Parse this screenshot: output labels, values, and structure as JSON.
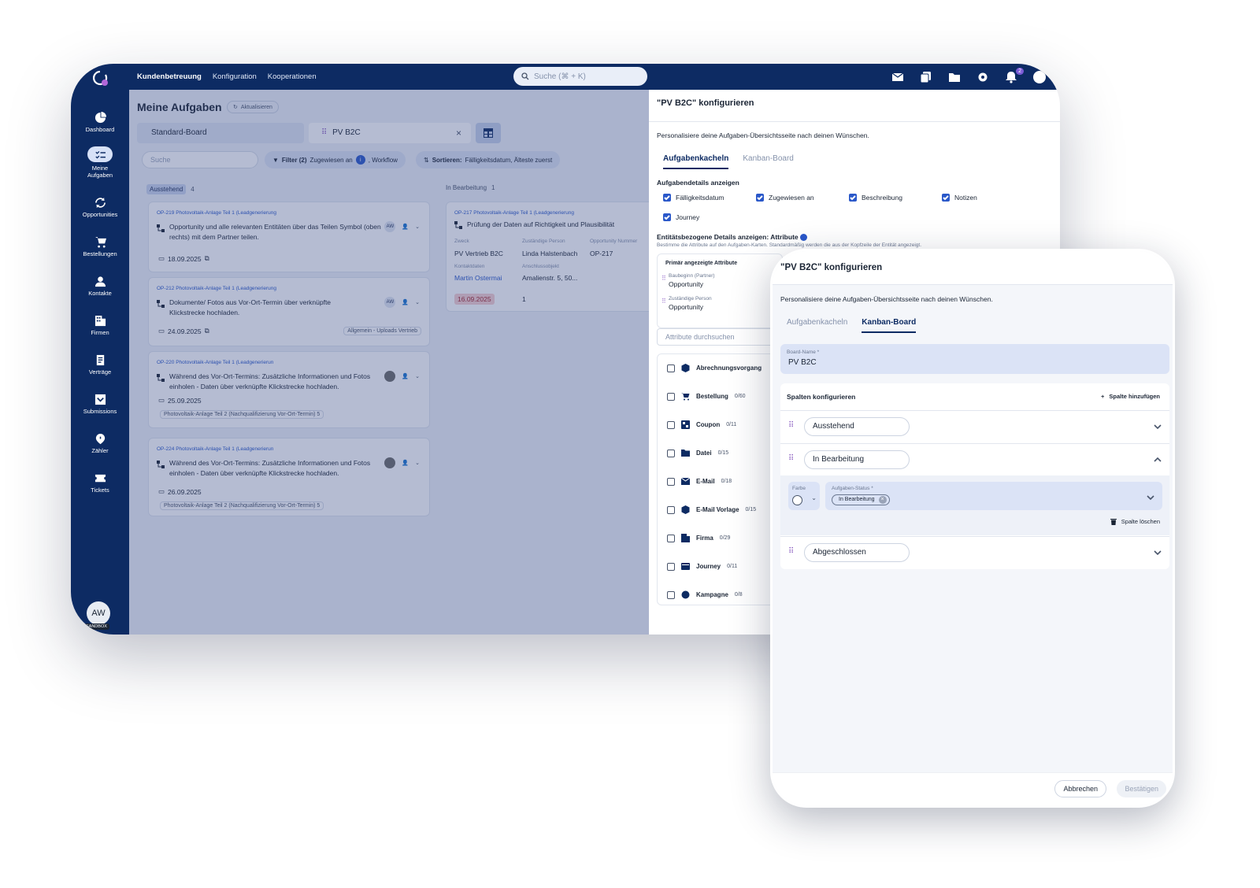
{
  "topnav": {
    "items": [
      "Kundenbetreuung",
      "Konfiguration",
      "Kooperationen"
    ],
    "search_placeholder": "Suche (⌘ + K)",
    "notification_count": "2"
  },
  "sidebar": {
    "items": [
      {
        "label": "Dashboard",
        "icon": "dashboard-icon"
      },
      {
        "label": "Meine Aufgaben",
        "icon": "tasks-icon"
      },
      {
        "label": "Opportunities",
        "icon": "refresh-icon"
      },
      {
        "label": "Bestellungen",
        "icon": "cart-icon"
      },
      {
        "label": "Kontakte",
        "icon": "person-icon"
      },
      {
        "label": "Firmen",
        "icon": "building-icon"
      },
      {
        "label": "Verträge",
        "icon": "contract-icon"
      },
      {
        "label": "Submissions",
        "icon": "inbox-icon"
      },
      {
        "label": "Zähler",
        "icon": "gauge-icon"
      },
      {
        "label": "Tickets",
        "icon": "ticket-icon"
      }
    ],
    "user_initials": "AW",
    "env_badge": "SANDBOX"
  },
  "main": {
    "title": "Meine Aufgaben",
    "refresh_label": "Aktualisieren",
    "board_tabs": [
      "Standard-Board",
      "PV B2C"
    ],
    "search_placeholder": "Suche",
    "filter_label": "Filter (2)",
    "filter_text_a": "Zugewiesen an",
    "filter_text_b": ", Workflow",
    "filter_badge": "i",
    "sort_label": "Sortieren:",
    "sort_value": "Fälligkeitsdatum, Älteste zuerst",
    "columns": [
      {
        "name": "Ausstehend",
        "count": "4"
      },
      {
        "name": "In Bearbeitung",
        "count": "1"
      }
    ],
    "cards": [
      {
        "ref": "OP-219 Photovoltaik-Anlage Teil 1 (Leadgenerierung",
        "title": "Opportunity und alle relevanten Entitäten über das Teilen Symbol (oben rechts) mit dem Partner teilen.",
        "date": "18.09.2025",
        "assignee": "AW",
        "tag": ""
      },
      {
        "ref": "OP-212 Photovoltaik-Anlage Teil 1 (Leadgenerierung",
        "title": "Dokumente/ Fotos aus Vor-Ort-Termin über verknüpfte Klickstrecke hochladen.",
        "date": "24.09.2025",
        "assignee": "AW",
        "tag": "Allgemein - Uploads Vertrieb"
      },
      {
        "ref": "OP-220 Photovoltaik-Anlage Teil 1 (Leadgenerierun",
        "title": "Während des Vor-Ort-Termins: Zusätzliche Informationen und Fotos einholen - Daten über verknüpfte Klickstrecke hochladen.",
        "date": "25.09.2025",
        "assignee": "",
        "tag": "Photovoltaik-Anlage Teil 2 (Nachqualifizierung Vor-Ort-Termin) 5"
      },
      {
        "ref": "OP-224 Photovoltaik-Anlage Teil 1 (Leadgenerierun",
        "title": "Während des Vor-Ort-Termins: Zusätzliche Informationen und Fotos einholen - Daten über verknüpfte Klickstrecke hochladen.",
        "date": "26.09.2025",
        "assignee": "",
        "tag": "Photovoltaik-Anlage Teil 2 (Nachqualifizierung Vor-Ort-Termin) 5"
      }
    ],
    "progress_card": {
      "ref": "OP-217 Photovoltaik-Anlage Teil 1 (Leadgenerierung",
      "title": "Prüfung der Daten auf Richtigkeit und Plausibilität",
      "zweck_label": "Zweck",
      "zweck": "PV Vertrieb B2C",
      "person_label": "Zuständige Person",
      "person": "Linda Halstenbach",
      "opnum_label": "Opportunity Nummer",
      "opnum": "OP-217",
      "kontakt_label": "Kontaktdaten",
      "kontakt": "Martin Ostermai",
      "objekt_label": "Anschlussobjekt",
      "objekt": "Amalienstr. 5, 50...",
      "date": "16.09.2025",
      "count": "1"
    }
  },
  "config_back": {
    "title": "\"PV B2C\" konfigurieren",
    "subtitle": "Personalisiere deine Aufgaben-Übersichtsseite nach deinen Wünschen.",
    "tabs": [
      "Aufgabenkacheln",
      "Kanban-Board"
    ],
    "details_heading": "Aufgabendetails anzeigen",
    "checkboxes": [
      "Fälligkeitsdatum",
      "Zugewiesen an",
      "Beschreibung",
      "Notizen",
      "Journey"
    ],
    "entity_heading": "Entitätsbezogene Details anzeigen: Attribute",
    "entity_hint": "Bestimme die Attribute auf den Aufgaben-Karten. Standardmäßig werden die aus der Kopfzeile der Entität angezeigt.",
    "primary_heading": "Primär angezeigte Attribute",
    "primary_attrs": [
      {
        "label": "Baubeginn (Partner)",
        "value": "Opportunity"
      },
      {
        "label": "Zuständige Person",
        "value": "Opportunity"
      }
    ],
    "attr_search_placeholder": "Attribute durchsuchen",
    "entities": [
      {
        "name": "Abrechnungsvorgang",
        "count": "",
        "icon": "cube-icon"
      },
      {
        "name": "Bestellung",
        "count": "0/60",
        "icon": "cart-icon"
      },
      {
        "name": "Coupon",
        "count": "0/11",
        "icon": "coupon-icon"
      },
      {
        "name": "Datei",
        "count": "0/15",
        "icon": "folder-icon"
      },
      {
        "name": "E-Mail",
        "count": "0/18",
        "icon": "mail-icon"
      },
      {
        "name": "E-Mail Vorlage",
        "count": "0/15",
        "icon": "cube-icon"
      },
      {
        "name": "Firma",
        "count": "0/29",
        "icon": "building-icon"
      },
      {
        "name": "Journey",
        "count": "0/11",
        "icon": "journey-icon"
      },
      {
        "name": "Kampagne",
        "count": "0/8",
        "icon": "campaign-icon"
      }
    ]
  },
  "config_front": {
    "title": "\"PV B2C\" konfigurieren",
    "subtitle": "Personalisiere deine Aufgaben-Übersichtsseite nach deinen Wünschen.",
    "tabs": [
      "Aufgabenkacheln",
      "Kanban-Board"
    ],
    "board_name_label": "Board-Name *",
    "board_name_value": "PV B2C",
    "columns_heading": "Spalten konfigurieren",
    "add_column_label": "Spalte hinzufügen",
    "columns": [
      "Ausstehend",
      "In Bearbeitung",
      "Abgeschlossen"
    ],
    "color_label": "Farbe",
    "status_label": "Aufgaben-Status *",
    "status_chip": "In Bearbeitung",
    "delete_column_label": "Spalte löschen",
    "cancel_label": "Abbrechen",
    "confirm_label": "Bestätigen"
  }
}
